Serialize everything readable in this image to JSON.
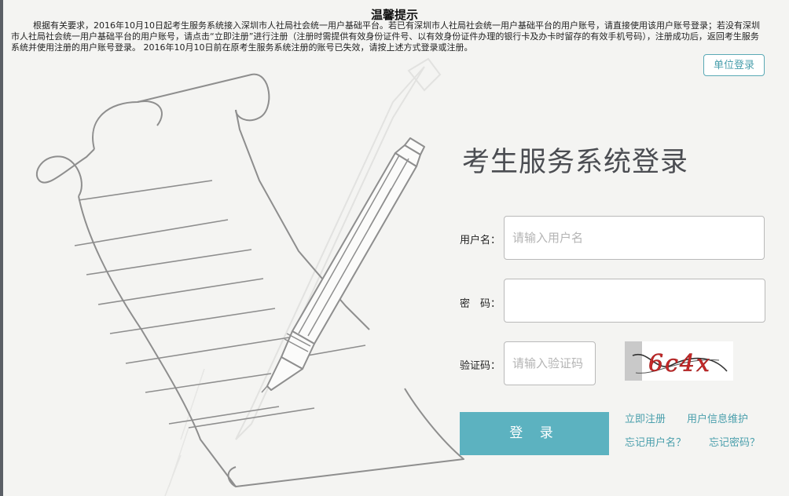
{
  "notice": {
    "title": "温馨提示",
    "body": "根据有关要求，2016年10月10日起考生服务系统接入深圳市人社局社会统一用户基础平台。若已有深圳市人社局社会统一用户基础平台的用户账号，请直接使用该用户账号登录；若没有深圳市人社局社会统一用户基础平台的用户账号，请点击“立即注册”进行注册（注册时需提供有效身份证件号、以有效身份证件办理的银行卡及办卡时留存的有效手机号码），注册成功后，返回考生服务系统并使用注册的用户账号登录。 2016年10月10日前在原考生服务系统注册的账号已失效，请按上述方式登录或注册。"
  },
  "header": {
    "unit_login": "单位登录"
  },
  "login": {
    "title": "考生服务系统登录",
    "username_label": "用户名：",
    "username_placeholder": "请输入用户名",
    "password_label": "密　码：",
    "captcha_label": "验证码：",
    "captcha_placeholder": "请输入验证码",
    "captcha_text": "6c4x",
    "submit": "登 录"
  },
  "links": {
    "register": "立即注册",
    "user_info": "用户信息维护",
    "forgot_username": "忘记用户名？",
    "forgot_password": "忘记密码？"
  },
  "colors": {
    "accent": "#5cb2c0",
    "link": "#4a9fac",
    "title": "#4b4d52"
  }
}
